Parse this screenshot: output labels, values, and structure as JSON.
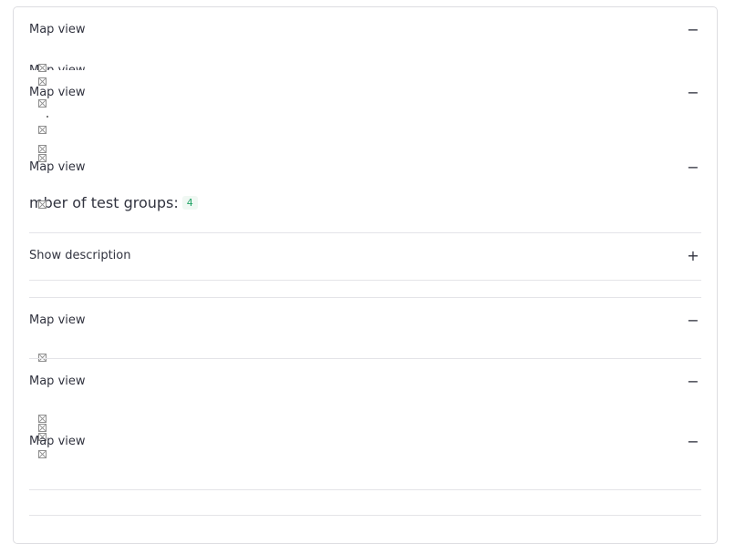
{
  "sections": [
    {
      "label": "Map view",
      "toggle": "−"
    },
    {
      "label": "Map view",
      "toggle": "−"
    },
    {
      "label": "Map view",
      "toggle": "−"
    },
    {
      "label": "Show description",
      "toggle": "+"
    },
    {
      "label": "Map view",
      "toggle": "−"
    },
    {
      "label": "Map view",
      "toggle": "−"
    },
    {
      "label": "Map view",
      "toggle": "−"
    }
  ],
  "overlaps": {
    "top_fragment": "Map view",
    "bottom_fragment": "Map view"
  },
  "test_groups": {
    "label": "mber of test groups:",
    "count": "4"
  },
  "icons": {
    "broken_image": "broken-image-icon"
  }
}
